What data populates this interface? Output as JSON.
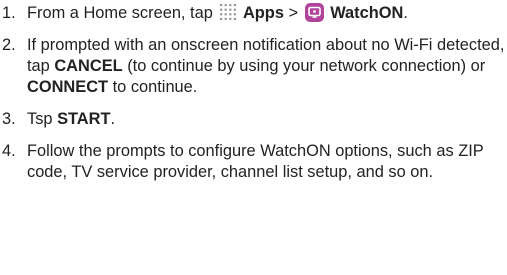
{
  "colors": {
    "text": "#222222",
    "apps_icon_dots": "#9a9a9a",
    "watchon_icon_bg": "#b0449a"
  },
  "icons": {
    "apps": "apps-grid-icon",
    "watchon": "watchon-app-icon"
  },
  "steps": [
    {
      "number": "1.",
      "text_a": "From a Home screen, tap ",
      "bold_a": "Apps",
      "text_b": " > ",
      "bold_b": "WatchON",
      "text_c": "."
    },
    {
      "number": "2.",
      "text_a": "If prompted with an onscreen notification about no Wi-Fi detected, tap ",
      "bold_a": "CANCEL",
      "text_b": " (to continue by using your network connection) or ",
      "bold_b": "CONNECT",
      "text_c": " to continue."
    },
    {
      "number": "3.",
      "text_a": "Tsp ",
      "bold_a": "START",
      "text_b": "."
    },
    {
      "number": "4.",
      "text_a": "Follow the prompts to configure WatchON options, such as ZIP code, TV service provider, channel list setup, and so on."
    }
  ]
}
